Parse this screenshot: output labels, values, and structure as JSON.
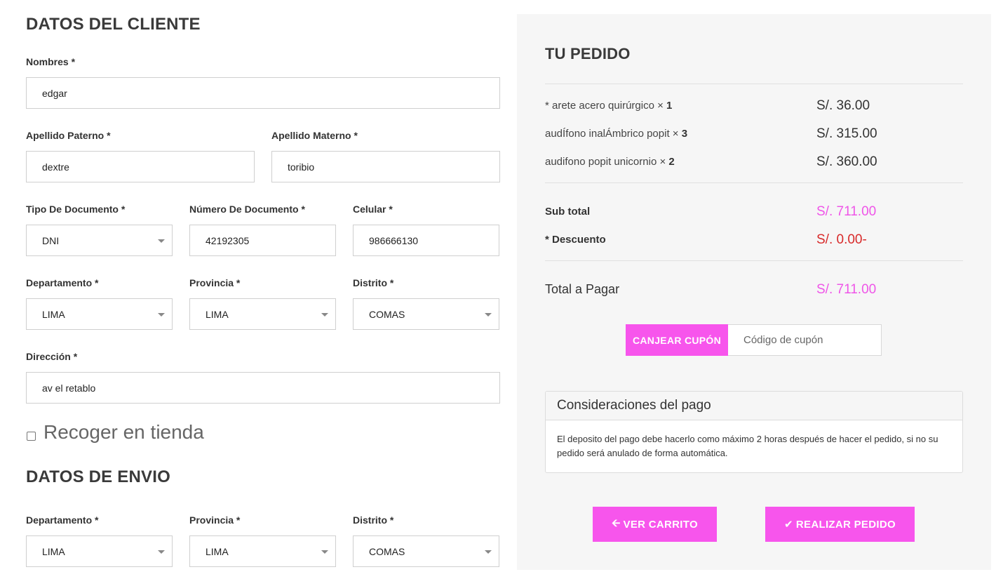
{
  "client": {
    "title": "DATOS DEL CLIENTE",
    "nombres_label": "Nombres *",
    "nombres_value": "edgar",
    "apellido_paterno_label": "Apellido Paterno *",
    "apellido_paterno_value": "dextre",
    "apellido_materno_label": "Apellido Materno *",
    "apellido_materno_value": "toribio",
    "tipo_doc_label": "Tipo De Documento *",
    "tipo_doc_value": "DNI",
    "num_doc_label": "Número De Documento *",
    "num_doc_value": "42192305",
    "celular_label": "Celular *",
    "celular_value": "986666130",
    "departamento_label": "Departamento *",
    "departamento_value": "LIMA",
    "provincia_label": "Provincia *",
    "provincia_value": "LIMA",
    "distrito_label": "Distrito *",
    "distrito_value": "COMAS",
    "direccion_label": "Dirección *",
    "direccion_value": "av el retablo",
    "recoger_label": "Recoger en tienda"
  },
  "shipping": {
    "title": "DATOS DE ENVIO",
    "departamento_label": "Departamento *",
    "departamento_value": "LIMA",
    "provincia_label": "Provincia *",
    "provincia_value": "LIMA",
    "distrito_label": "Distrito *",
    "distrito_value": "COMAS"
  },
  "order": {
    "title": "TU PEDIDO",
    "items": [
      {
        "name": "* arete acero quirúrgico × ",
        "qty": "1",
        "price": "S/. 36.00"
      },
      {
        "name": "audÍfono inalÁmbrico popit × ",
        "qty": "3",
        "price": "S/. 315.00"
      },
      {
        "name": "audifono popit unicornio × ",
        "qty": "2",
        "price": "S/. 360.00"
      }
    ],
    "subtotal_label": "Sub total",
    "subtotal_value": "S/. 711.00",
    "descuento_label": "* Descuento",
    "descuento_value": "S/. 0.00-",
    "total_label": "Total a Pagar",
    "total_value": "S/. 711.00",
    "coupon_button": "CANJEAR CUPÓN",
    "coupon_placeholder": "Código de cupón",
    "payment_title": "Consideraciones del pago",
    "payment_text": "El deposito del pago debe hacerlo como máximo 2 horas después de hacer el pedido, si no su pedido será anulado de forma automática.",
    "ver_carrito": "VER CARRITO",
    "realizar_pedido": "REALIZAR PEDIDO"
  },
  "colors": {
    "accent": "#f755ec",
    "price_pink": "#ef55e8",
    "discount_red": "#d82a2a",
    "panel_bg": "#f6f6f6"
  },
  "icons": {
    "select_arrow": "chevron-down-icon",
    "back": "arrow-left-icon",
    "check": "check-icon"
  }
}
